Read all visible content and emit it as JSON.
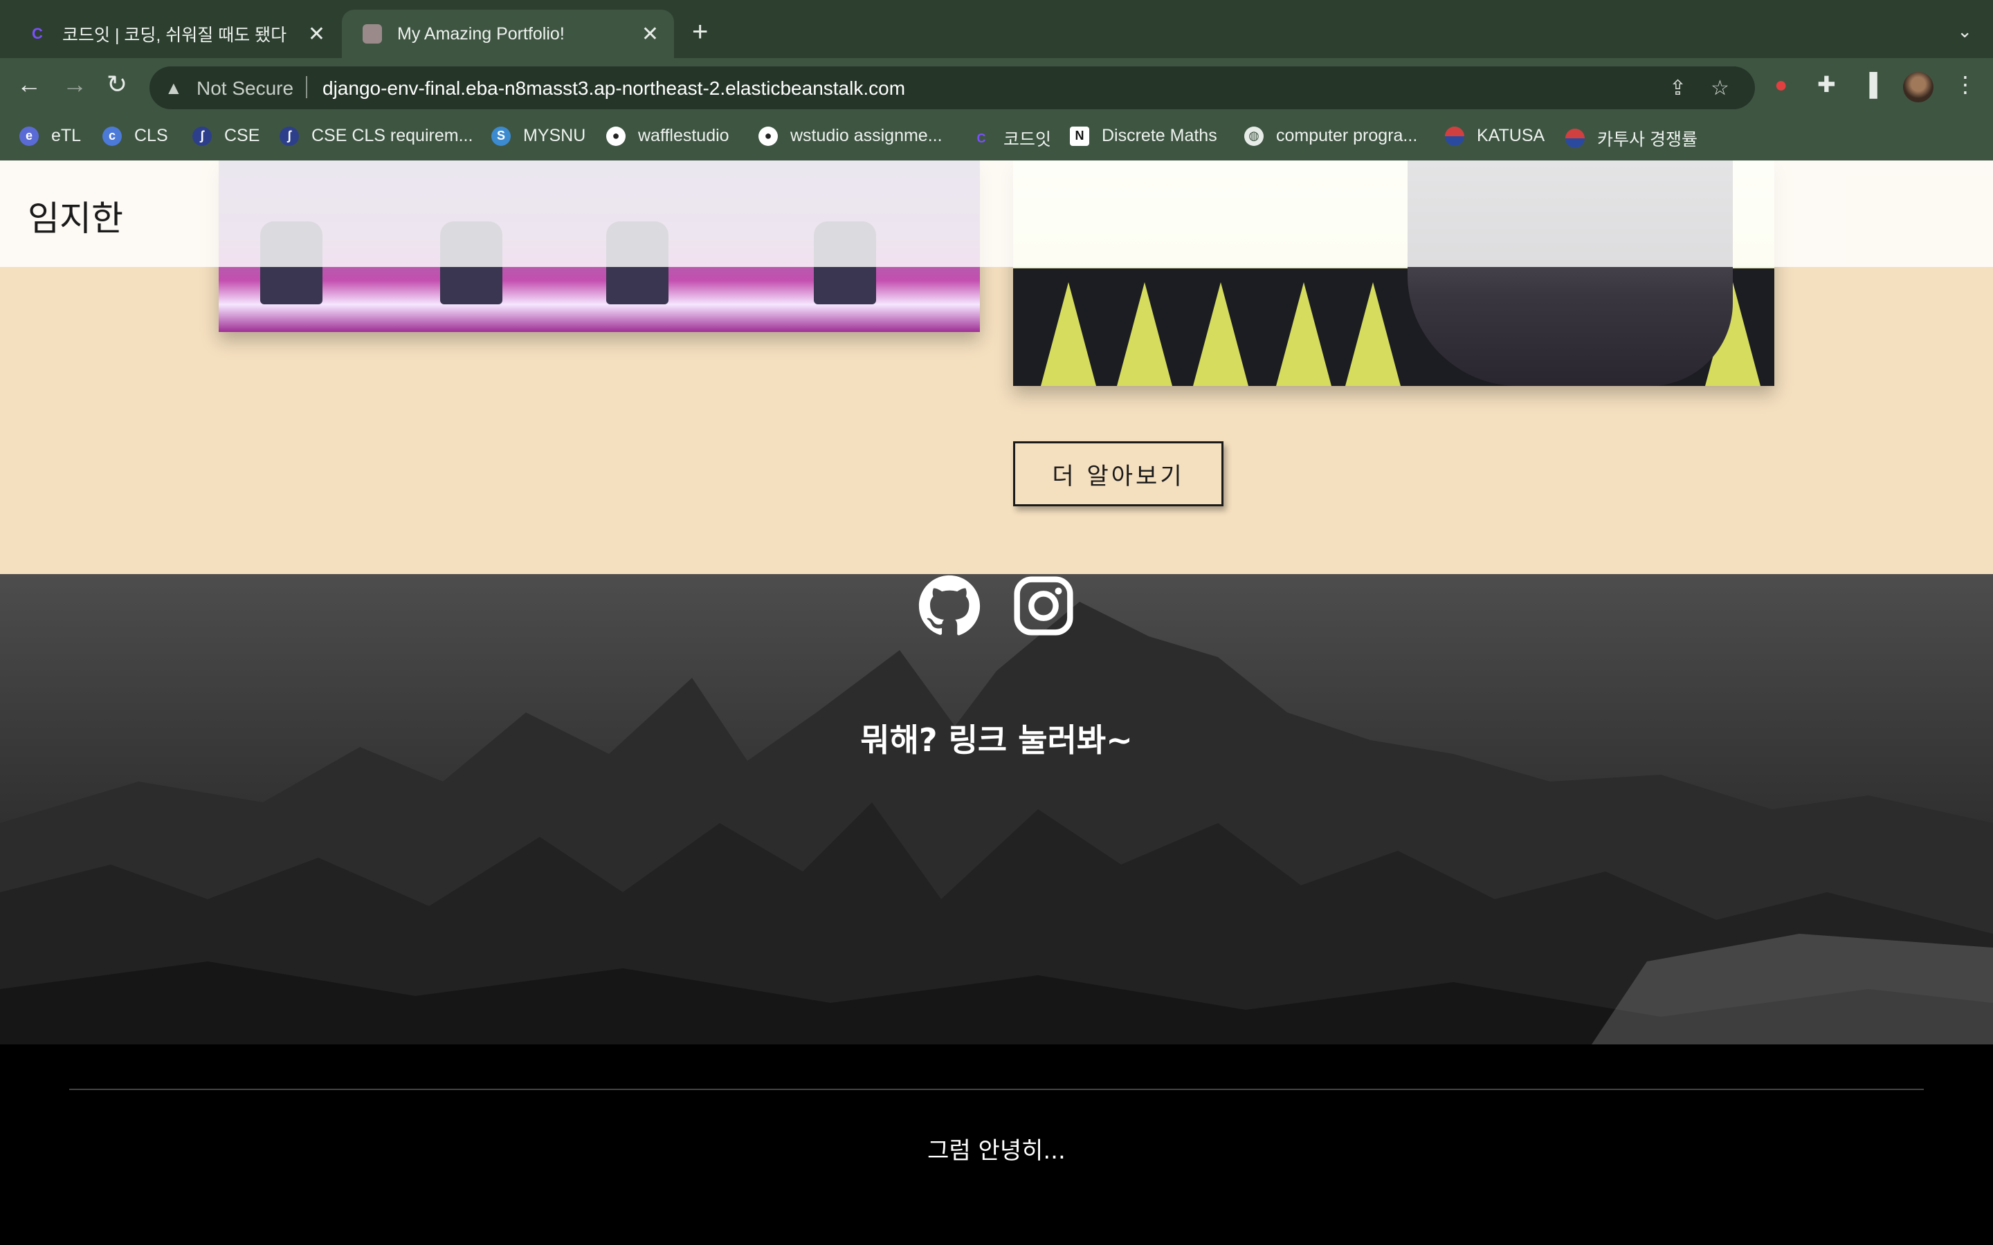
{
  "browser": {
    "tabs": [
      {
        "title": "코드잇 | 코딩, 쉬워질 때도 됐다",
        "favicon": "codeit-icon",
        "active": false
      },
      {
        "title": "My Amazing Portfolio!",
        "favicon": "portfolio-icon",
        "active": true
      }
    ],
    "new_tab_symbol": "+",
    "address": {
      "security_label": "Not Secure",
      "url": "django-env-final.eba-n8masst3.ap-northeast-2.elasticbeanstalk.com"
    },
    "bookmarks": [
      {
        "label": "eTL",
        "icon": "etl-icon",
        "color": "#5b6bd6"
      },
      {
        "label": "CLS",
        "icon": "cls-icon",
        "color": "#4c7ad8"
      },
      {
        "label": "CSE",
        "icon": "cse-icon",
        "color": "#2d3f8a"
      },
      {
        "label": "CSE CLS requirem...",
        "icon": "cse-icon",
        "color": "#2d3f8a"
      },
      {
        "label": "MYSNU",
        "icon": "mysnu-icon",
        "color": "#3c8bd0"
      },
      {
        "label": "wafflestudio",
        "icon": "github-icon",
        "color": "#ffffff"
      },
      {
        "label": "wstudio assignme...",
        "icon": "github-icon",
        "color": "#ffffff"
      },
      {
        "label": "코드잇",
        "icon": "codeit-icon",
        "color": "#6b3fe0"
      },
      {
        "label": "Discrete Maths",
        "icon": "notion-icon",
        "color": "#ffffff"
      },
      {
        "label": "computer progra...",
        "icon": "globe-icon",
        "color": "#ffffff"
      },
      {
        "label": "KATUSA",
        "icon": "katusa-icon",
        "color": "#d04040"
      },
      {
        "label": "카투사 경쟁률",
        "icon": "katusa-icon",
        "color": "#d04040"
      }
    ]
  },
  "page": {
    "header_name": "임지한",
    "more_button": "더 알아보기",
    "tagline": "뭐해? 링크 눌러봐~",
    "social": [
      {
        "name": "github-icon"
      },
      {
        "name": "instagram-icon"
      }
    ],
    "footer_text": "그럼 안녕히..."
  },
  "colors": {
    "chrome_dark": "#2d4030",
    "chrome": "#3e5542",
    "peach_section": "#f4dfbf",
    "footer": "#000000"
  }
}
